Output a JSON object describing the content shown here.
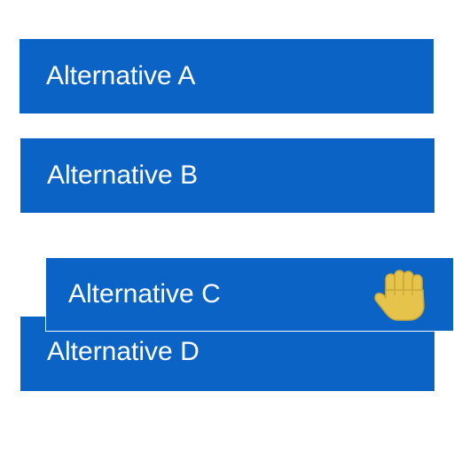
{
  "colors": {
    "option_bg": "#0a63c5",
    "hand": "#e6c34a",
    "hand_outline": "#c9a736"
  },
  "list": {
    "items": [
      {
        "label": "Alternative A"
      },
      {
        "label": "Alternative B"
      },
      {
        "label": "Alternative C",
        "state": "dragging"
      },
      {
        "label": "Alternative D"
      }
    ]
  },
  "cursor": {
    "icon": "grab-hand-icon"
  }
}
